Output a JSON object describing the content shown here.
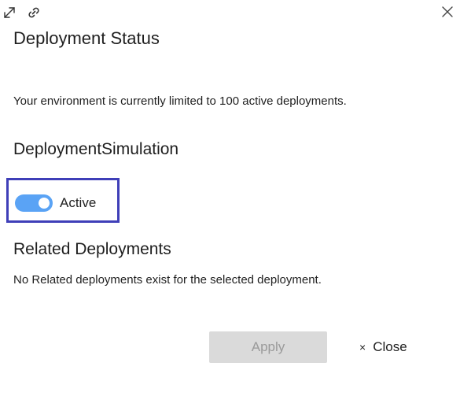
{
  "header": {
    "title": "Deployment Status",
    "icons": {
      "expand": "expand-icon",
      "link": "link-icon",
      "close": "close-icon"
    }
  },
  "info": {
    "limit_text": "Your environment is currently limited to 100 active deployments."
  },
  "simulation": {
    "name": "DeploymentSimulation",
    "toggle_label": "Active",
    "toggle_on": true
  },
  "related": {
    "title": "Related Deployments",
    "empty_text": "No Related deployments exist for the selected deployment."
  },
  "footer": {
    "apply_label": "Apply",
    "close_label": "Close",
    "close_glyph": "×"
  },
  "colors": {
    "toggle_on": "#5aa3f5",
    "highlight_border": "#3f3fb8",
    "apply_disabled_bg": "#dadada",
    "apply_disabled_text": "#9a9a9a"
  }
}
